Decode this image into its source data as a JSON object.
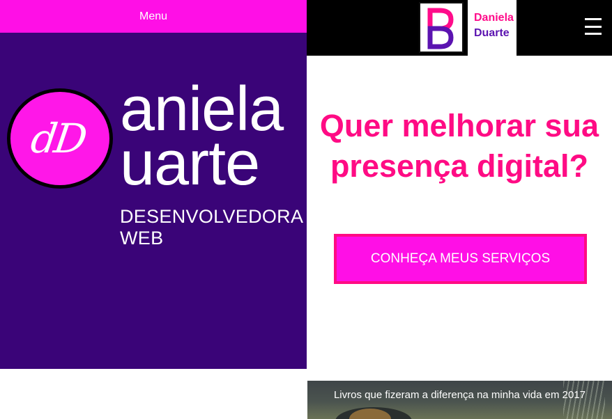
{
  "menu": {
    "label": "Menu"
  },
  "hero": {
    "monogram": "dD",
    "brand_line1": "aniela",
    "brand_line2": "uarte",
    "subtitle_line1": "DESENVOLVEDORA",
    "subtitle_line2": "WEB"
  },
  "header": {
    "logo_monogram": "DD",
    "logo_word1": "Daniela",
    "logo_word2": "Duarte",
    "menu_icon": "hamburger-icon"
  },
  "main": {
    "headline_line1": "Quer melhorar sua",
    "headline_line2": "presença digital?",
    "cta_label": "CONHEÇA MEUS SERVIÇOS"
  },
  "post": {
    "title": "Livros que fizeram a diferença na minha vida em 2017"
  },
  "colors": {
    "magenta": "#ff0fe6",
    "pink": "#ff0b84",
    "purple": "#3a0478",
    "black": "#000000"
  }
}
